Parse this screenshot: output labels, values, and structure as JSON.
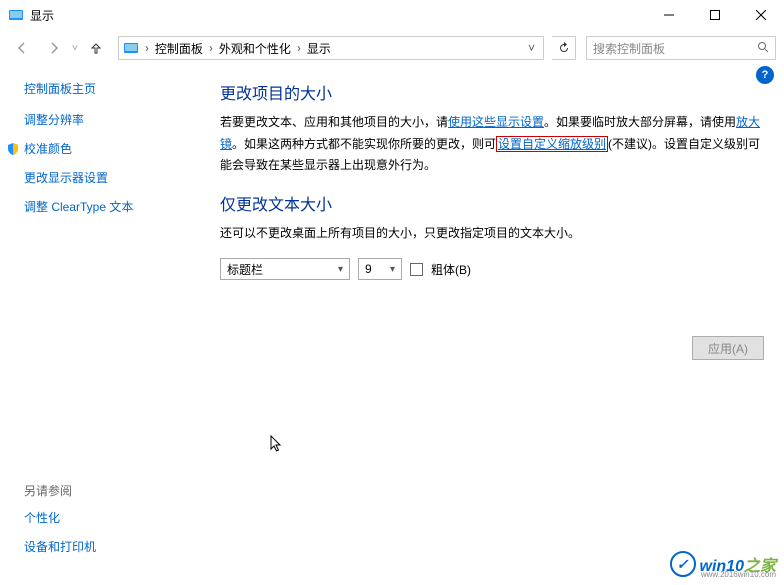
{
  "window": {
    "title": "显示"
  },
  "breadcrumb": {
    "root": "控制面板",
    "cat": "外观和个性化",
    "page": "显示"
  },
  "search": {
    "placeholder": "搜索控制面板"
  },
  "sidebar": {
    "home": "控制面板主页",
    "links": [
      "调整分辨率",
      "校准颜色",
      "更改显示器设置",
      "调整 ClearType 文本"
    ]
  },
  "see_also": {
    "header": "另请参阅",
    "items": [
      "个性化",
      "设备和打印机"
    ]
  },
  "content": {
    "heading1": "更改项目的大小",
    "para1_a": "若要更改文本、应用和其他项目的大小，请",
    "para1_link1": "使用这些显示设置",
    "para1_b": "。如果要临时放大部分屏幕，请使用",
    "para1_link2": "放大镜",
    "para1_c": "。如果这两种方式都不能实现你所要的更改，则可",
    "para1_link3": "设置自定义缩放级别",
    "para1_d": "(不建议)。设置自定义级别可能会导致在某些显示器上出现意外行为。",
    "heading2": "仅更改文本大小",
    "para2": "还可以不更改桌面上所有项目的大小，只更改指定项目的文本大小。",
    "select_item": "标题栏",
    "select_size": "9",
    "bold_label": "粗体(B)",
    "apply_label": "应用(A)"
  },
  "watermark": {
    "text1": "win10",
    "text2": "之家",
    "url": "www.2016win10.com"
  }
}
